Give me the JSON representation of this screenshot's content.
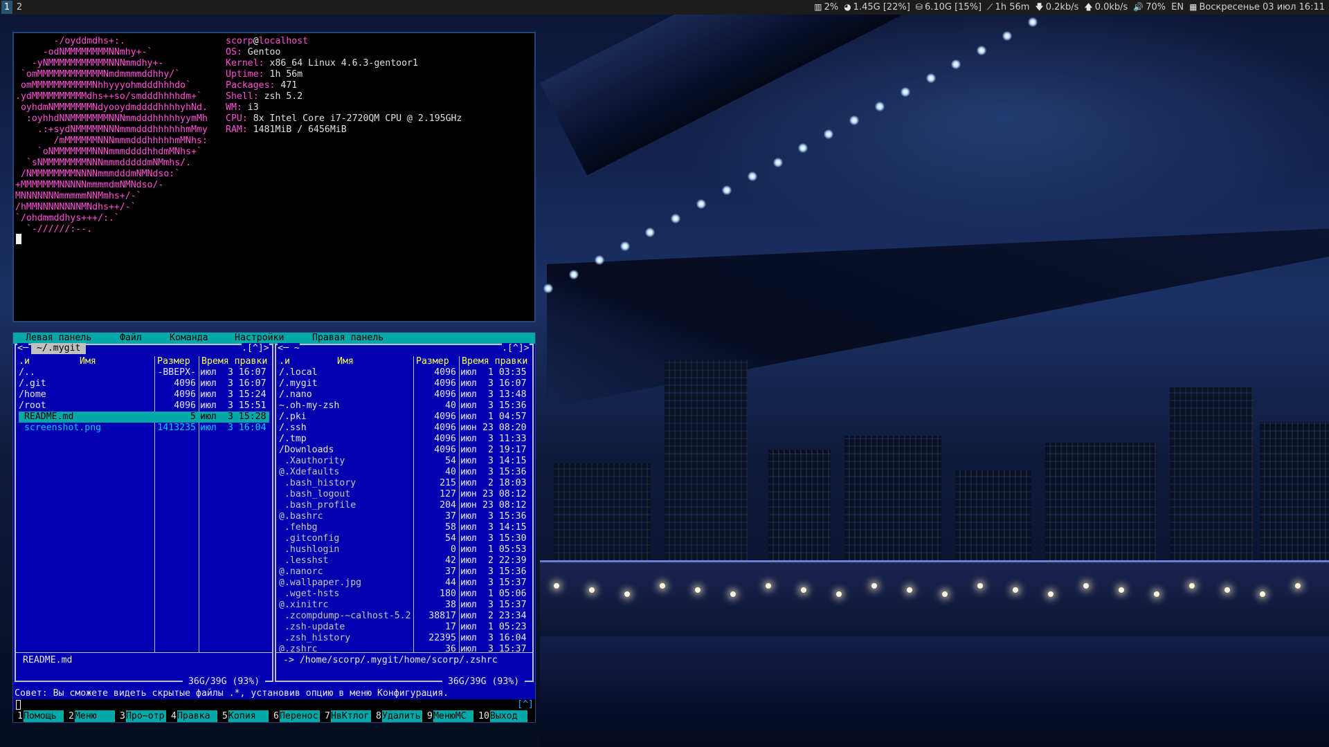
{
  "topbar": {
    "workspaces": [
      {
        "label": "1",
        "active": true
      },
      {
        "label": "2",
        "active": false
      }
    ],
    "status": [
      {
        "icon": "chart-bars-icon",
        "glyph": "▥",
        "text": "2%"
      },
      {
        "icon": "pie-memory-icon",
        "glyph": "◕",
        "text": "1.45G [22%]"
      },
      {
        "icon": "disk-icon",
        "glyph": "⛁",
        "text": "6.10G [15%]"
      },
      {
        "icon": "uptime-graph-icon",
        "glyph": "⟋",
        "text": "1h 56m"
      },
      {
        "icon": "download-arrow-icon",
        "glyph": "🡇",
        "text": "0.2kb/s"
      },
      {
        "icon": "upload-arrow-icon",
        "glyph": "🡅",
        "text": "0.0kb/s"
      },
      {
        "icon": "volume-icon",
        "glyph": "🔊",
        "text": "70%"
      },
      {
        "icon": "keyboard-layout",
        "glyph": "",
        "text": "EN"
      },
      {
        "icon": "calendar-icon",
        "glyph": "▦",
        "text": "Воскресенье 03 июл 16:11"
      }
    ]
  },
  "terminal": {
    "ascii_lines": [
      "       -/oyddmdhs+:.",
      "     -odNMMMMMMMMNNmhy+-`",
      "   -yNMMMMMMMMMMMNNNmmdhy+-",
      " `omMMMMMMMMMMMMNmdmmmmddhhy/`",
      " omMMMMMMMMMMMNhhyyyohmdddhhhdo`",
      ".ydMMMMMMMMMMdhs++so/smdddhhhhdm+`",
      " oyhdmNMMMMMMMNdyooydmddddhhhhyhNd.",
      "  :oyhhdNNMMMMMMMNNNmmdddhhhhhyymMh",
      "    .:+sydNMMMMMNNNmmmdddhhhhhhmMmy",
      "       /mMMMMMMNNNmmmdddhhhhhmMNhs:",
      "    `oNMMMMMMMNNNmmmddddhhdmMNhs+`",
      "  `sNMMMMMMMMNNNmmmdddddmNMmhs/.",
      " /NMMMMMMMMNNNNmmmdddmNMNdso:`",
      "+MMMMMMMNNNNNmmmmdmNMNdso/-",
      "MNNNNNNNmmmmmNNMmhs+/-`",
      "/hMMNNNNNNNNMNdhs++/-`",
      "`/ohdmmddhys+++/:.`",
      "  `-//////:--."
    ],
    "info": [
      {
        "key": "",
        "value": ""
      },
      {
        "key": "OS:",
        "value": " Gentoo"
      },
      {
        "key": "Kernel:",
        "value": " x86_64 Linux 4.6.3-gentoor1"
      },
      {
        "key": "Uptime:",
        "value": " 1h 56m"
      },
      {
        "key": "Packages:",
        "value": " 471"
      },
      {
        "key": "Shell:",
        "value": " zsh 5.2"
      },
      {
        "key": "WM:",
        "value": " i3"
      },
      {
        "key": "CPU:",
        "value": " 8x Intel Core i7-2720QM CPU @ 2.195GHz"
      },
      {
        "key": "RAM:",
        "value": " 1481MiB / 6456MiB"
      }
    ],
    "user": "scorp",
    "at": "@",
    "host": "localhost"
  },
  "mc": {
    "menu": [
      "Левая панель",
      "Файл",
      "Команда",
      "Настройки",
      "Правая панель"
    ],
    "left": {
      "title_prefix": "<─",
      "title": " ~/.mygit ",
      "title_suffix": ".[^]>",
      "hdr_sort": ".и",
      "hdr_name": "Имя",
      "hdr_size": "Размер",
      "hdr_time": "Время правки",
      "rows": [
        {
          "name": "/..",
          "size": "-ВВЕРХ-",
          "mon": "июл",
          "time": " 3 16:07",
          "kind": ""
        },
        {
          "name": "/.git",
          "size": "4096",
          "mon": "июл",
          "time": " 3 16:07",
          "kind": ""
        },
        {
          "name": "/home",
          "size": "4096",
          "mon": "июл",
          "time": " 3 15:24",
          "kind": ""
        },
        {
          "name": "/root",
          "size": "4096",
          "mon": "июл",
          "time": " 3 15:51",
          "kind": ""
        },
        {
          "name": " README.md",
          "size": "5",
          "mon": "июл",
          "time": " 3 15:28",
          "kind": "cur"
        },
        {
          "name": " screenshot.png",
          "size": "1413235",
          "mon": "июл",
          "time": " 3 16:04",
          "kind": "hi"
        }
      ],
      "mini": "README.md",
      "free": " 36G/39G (93%) "
    },
    "right": {
      "title_prefix": "<─ ~",
      "title_suffix": ".[^]>",
      "hdr_sort": ".и",
      "hdr_name": "Имя",
      "hdr_size": "Размер",
      "hdr_time": "Время правки",
      "rows": [
        {
          "name": "/.local",
          "size": "4096",
          "mon": "июл",
          "time": " 1 03:35",
          "kind": ""
        },
        {
          "name": "/.mygit",
          "size": "4096",
          "mon": "июл",
          "time": " 3 16:07",
          "kind": ""
        },
        {
          "name": "/.nano",
          "size": "4096",
          "mon": "июл",
          "time": " 3 13:48",
          "kind": ""
        },
        {
          "name": "~.oh-my-zsh",
          "size": "40",
          "mon": "июл",
          "time": " 3 15:36",
          "kind": ""
        },
        {
          "name": "/.pki",
          "size": "4096",
          "mon": "июл",
          "time": " 1 04:57",
          "kind": ""
        },
        {
          "name": "/.ssh",
          "size": "4096",
          "mon": "июн",
          "time": "23 08:20",
          "kind": ""
        },
        {
          "name": "/.tmp",
          "size": "4096",
          "mon": "июл",
          "time": " 3 11:33",
          "kind": ""
        },
        {
          "name": "/Downloads",
          "size": "4096",
          "mon": "июл",
          "time": " 2 19:17",
          "kind": ""
        },
        {
          "name": " .Xauthority",
          "size": "54",
          "mon": "июл",
          "time": " 3 14:15",
          "kind": "dim"
        },
        {
          "name": "@.Xdefaults",
          "size": "40",
          "mon": "июл",
          "time": " 3 15:36",
          "kind": "dim"
        },
        {
          "name": " .bash_history",
          "size": "215",
          "mon": "июл",
          "time": " 2 18:03",
          "kind": "dim"
        },
        {
          "name": " .bash_logout",
          "size": "127",
          "mon": "июн",
          "time": "23 08:12",
          "kind": "dim"
        },
        {
          "name": " .bash_profile",
          "size": "204",
          "mon": "июн",
          "time": "23 08:12",
          "kind": "dim"
        },
        {
          "name": "@.bashrc",
          "size": "37",
          "mon": "июл",
          "time": " 3 15:36",
          "kind": "dim"
        },
        {
          "name": " .fehbg",
          "size": "58",
          "mon": "июл",
          "time": " 3 14:15",
          "kind": "dim"
        },
        {
          "name": " .gitconfig",
          "size": "54",
          "mon": "июл",
          "time": " 3 15:30",
          "kind": "dim"
        },
        {
          "name": " .hushlogin",
          "size": "0",
          "mon": "июл",
          "time": " 1 05:53",
          "kind": "dim"
        },
        {
          "name": " .lesshst",
          "size": "42",
          "mon": "июл",
          "time": " 2 22:39",
          "kind": "dim"
        },
        {
          "name": "@.nanorc",
          "size": "37",
          "mon": "июл",
          "time": " 3 15:36",
          "kind": "dim"
        },
        {
          "name": "@.wallpaper.jpg",
          "size": "44",
          "mon": "июл",
          "time": " 3 15:37",
          "kind": "dim"
        },
        {
          "name": " .wget-hsts",
          "size": "180",
          "mon": "июл",
          "time": " 1 05:06",
          "kind": "dim"
        },
        {
          "name": "@.xinitrc",
          "size": "38",
          "mon": "июл",
          "time": " 3 15:37",
          "kind": "dim"
        },
        {
          "name": " .zcompdump-~calhost-5.2",
          "size": "38817",
          "mon": "июл",
          "time": " 2 23:34",
          "kind": "dim"
        },
        {
          "name": " .zsh-update",
          "size": "17",
          "mon": "июл",
          "time": " 1 05:23",
          "kind": "dim"
        },
        {
          "name": " .zsh_history",
          "size": "22395",
          "mon": "июл",
          "time": " 3 16:04",
          "kind": "dim"
        },
        {
          "name": "@.zshrc",
          "size": "36",
          "mon": "июл",
          "time": " 3 15:37",
          "kind": "dim"
        }
      ],
      "mini": "-> /home/scorp/.mygit/home/scorp/.zshrc",
      "free": " 36G/39G (93%) "
    },
    "hint": "Совет: Вы сможете видеть скрытые файлы .*, установив опцию в меню Конфигурация.",
    "cmd_up": "[^]",
    "fkeys": [
      {
        "n": "1",
        "label": "Помощь"
      },
      {
        "n": "2",
        "label": "Меню"
      },
      {
        "n": "3",
        "label": "Про~отр"
      },
      {
        "n": "4",
        "label": "Правка"
      },
      {
        "n": "5",
        "label": "Копия"
      },
      {
        "n": "6",
        "label": "Перенос"
      },
      {
        "n": "7",
        "label": "НвКтлог"
      },
      {
        "n": "8",
        "label": "Удалить"
      },
      {
        "n": "9",
        "label": "МенюMC"
      },
      {
        "n": "10",
        "label": "Выход"
      }
    ]
  }
}
